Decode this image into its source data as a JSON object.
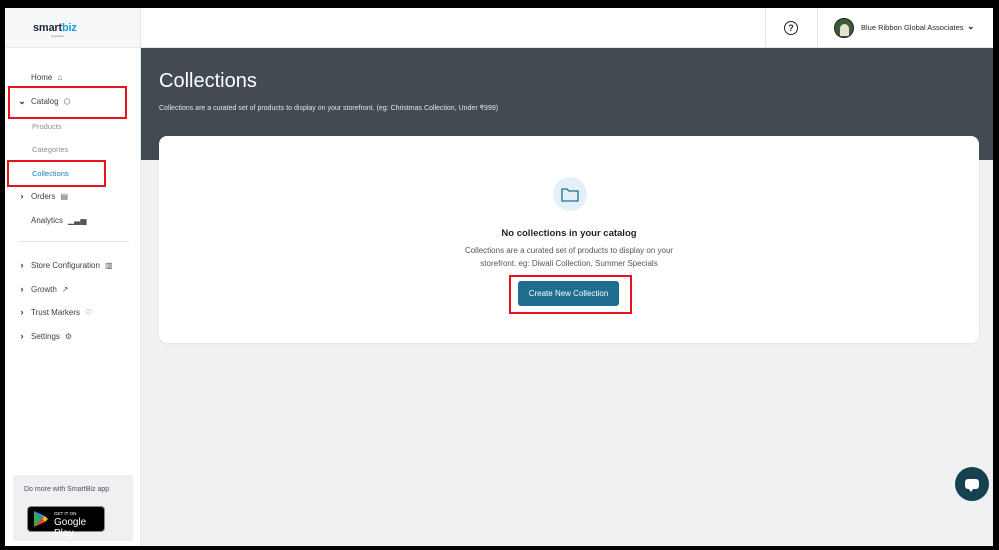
{
  "brand": {
    "logo_main": "smart",
    "logo_accent": "biz",
    "logo_sub": "by amazon"
  },
  "sidebar": {
    "items": [
      {
        "label": "Home",
        "icon": "home-icon"
      },
      {
        "label": "Catalog",
        "icon": "cube-icon",
        "expanded": true,
        "children": [
          {
            "label": "Products"
          },
          {
            "label": "Categories"
          },
          {
            "label": "Collections",
            "active": true
          }
        ]
      },
      {
        "label": "Orders",
        "icon": "clipboard-icon"
      },
      {
        "label": "Analytics",
        "icon": "bar-chart-icon"
      },
      {
        "label": "Store Configuration",
        "icon": "store-icon"
      },
      {
        "label": "Growth",
        "icon": "trend-up-icon"
      },
      {
        "label": "Trust Markers",
        "icon": "badge-icon"
      },
      {
        "label": "Settings",
        "icon": "gear-icon"
      }
    ],
    "promo": {
      "text": "Do more with SmartBiz app",
      "store_small": "GET IT ON",
      "store_big": "Google Play"
    }
  },
  "topbar": {
    "help_glyph": "?",
    "user_name": "Blue Ribbon Global Associates"
  },
  "page": {
    "title": "Collections",
    "subtitle": "Collections are a curated set of products to display on your storefront. (eg: Christmas Collection, Under ₹999)"
  },
  "empty_state": {
    "title": "No collections in your catalog",
    "description": "Collections are a curated set of products to display on your storefront. eg: Diwali Collection, Summer Specials",
    "button": "Create New Collection"
  },
  "colors": {
    "header": "#434a52",
    "primary_button": "#1e6d8f",
    "active_link": "#1a7fb8",
    "highlight": "#e8121b"
  }
}
